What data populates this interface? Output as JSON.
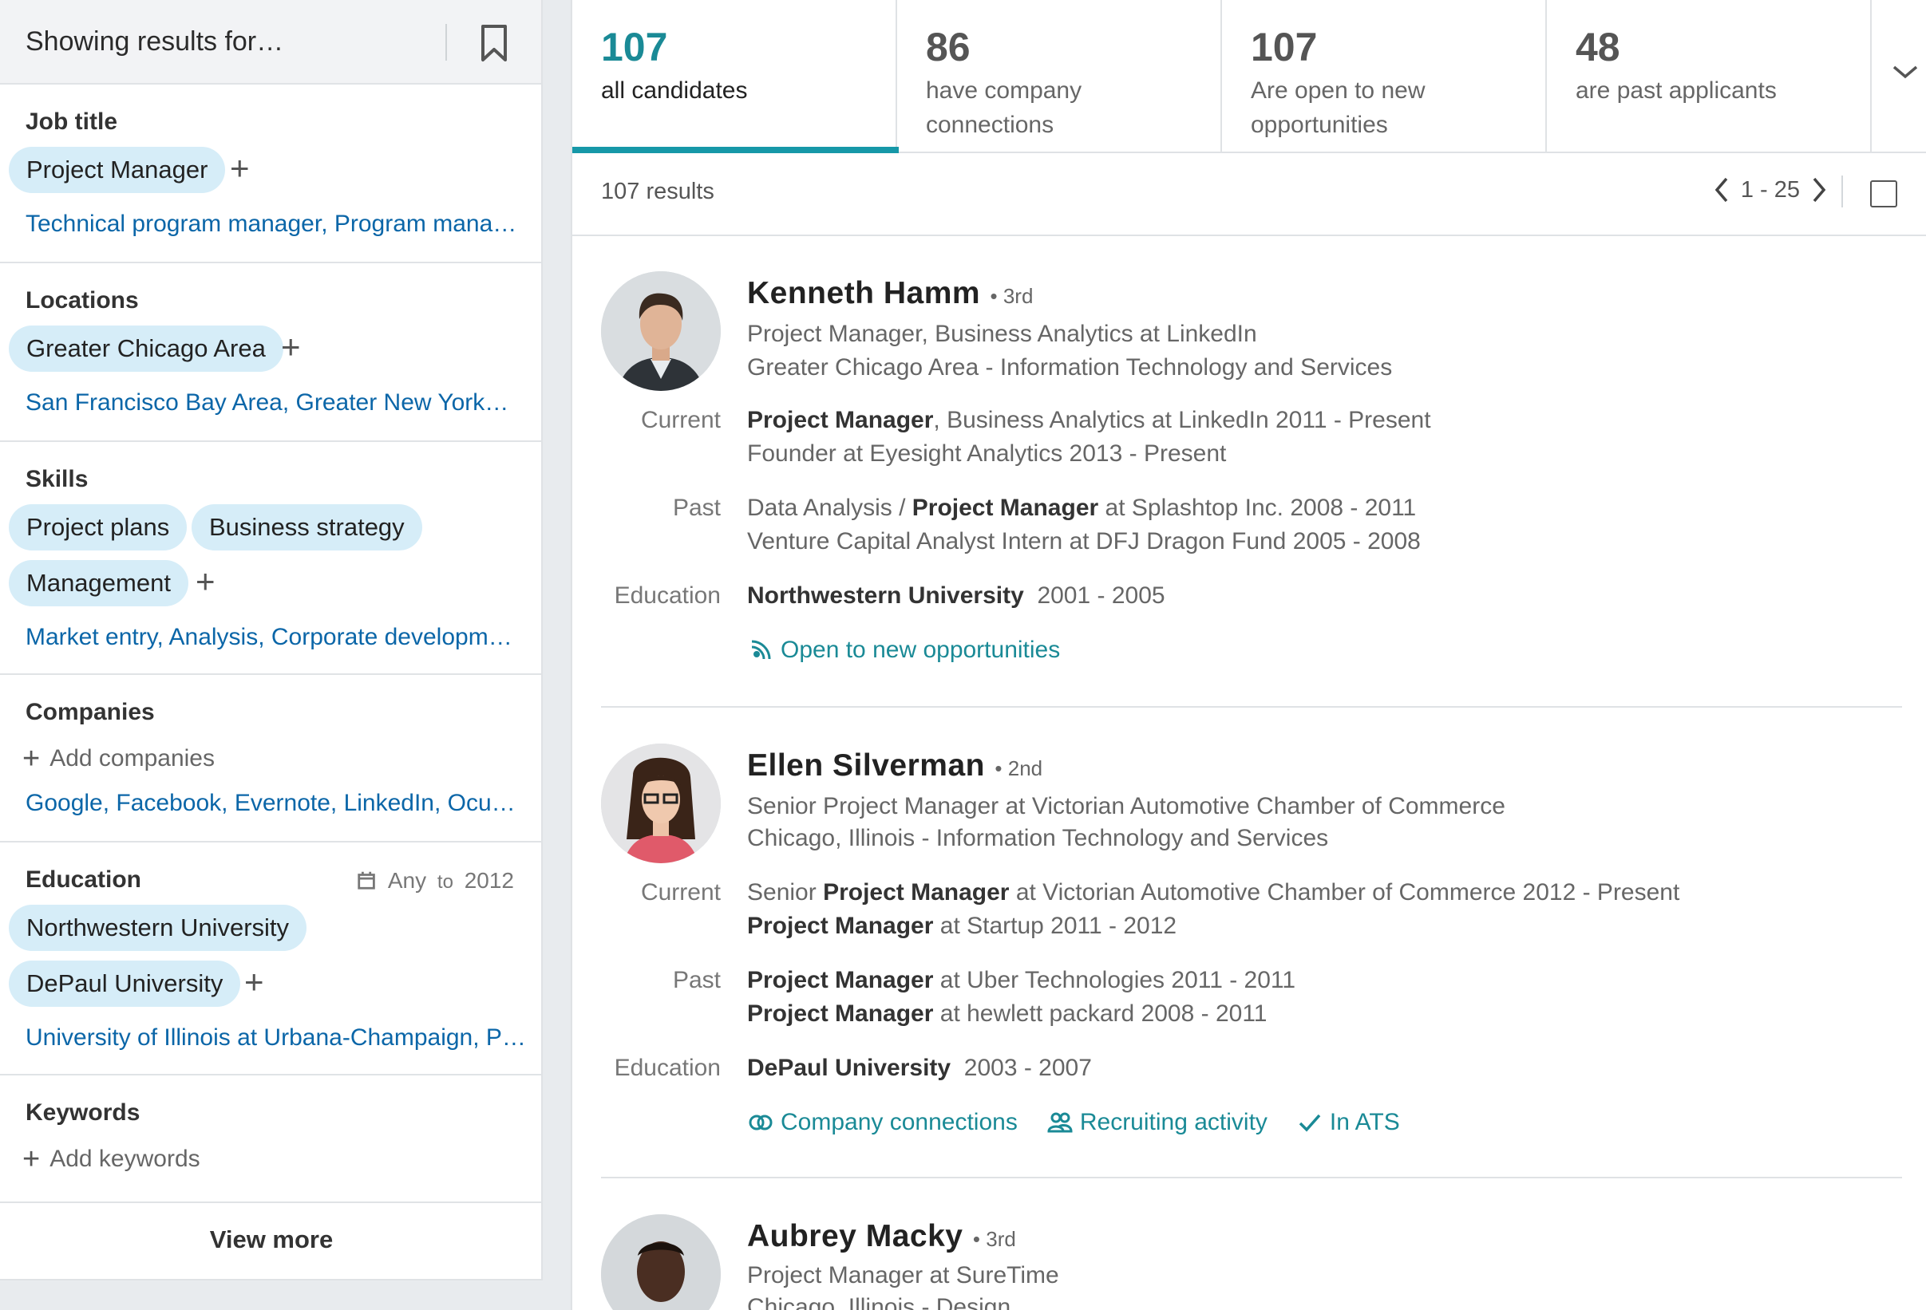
{
  "sidebar": {
    "header_title": "Showing results for…",
    "job_title": {
      "title": "Job title",
      "pills": [
        "Project Manager"
      ],
      "suggestion": "Technical program manager, Program mana…"
    },
    "locations": {
      "title": "Locations",
      "pills": [
        "Greater Chicago Area"
      ],
      "suggestion": "San Francisco Bay Area, Greater New York…"
    },
    "skills": {
      "title": "Skills",
      "pills": [
        "Project plans",
        "Business strategy",
        "Management"
      ],
      "suggestion": "Market entry, Analysis, Corporate developm…"
    },
    "companies": {
      "title": "Companies",
      "add_label": "Add companies",
      "suggestion": "Google, Facebook, Evernote, LinkedIn, Ocu…"
    },
    "education": {
      "title": "Education",
      "range_from": "Any",
      "range_to_label": "to",
      "range_to": "2012",
      "pills": [
        "Northwestern University",
        "DePaul University"
      ],
      "suggestion": "University of Illinois at Urbana-Champaign, P…"
    },
    "keywords": {
      "title": "Keywords",
      "add_label": "Add keywords"
    },
    "view_more": "View more"
  },
  "tabs": [
    {
      "count": "107",
      "label": "all candidates",
      "active": true
    },
    {
      "count": "86",
      "label": "have company connections"
    },
    {
      "count": "107",
      "label": "Are open to new opportunities"
    },
    {
      "count": "48",
      "label": "are past applicants"
    }
  ],
  "results": {
    "count_label": "107 results",
    "page_range": "1 - 25"
  },
  "labels": {
    "current": "Current",
    "past": "Past",
    "education": "Education"
  },
  "candidates": [
    {
      "name": "Kenneth Hamm",
      "degree": "• 3rd",
      "headline": "Project Manager, Business Analytics at LinkedIn",
      "location": "Greater Chicago Area - Information Technology and Services",
      "current": [
        {
          "pre": "",
          "bold": "Project Manager",
          "post": ", Business Analytics at LinkedIn  2011 - Present"
        },
        {
          "pre": "Founder at Eyesight Analytics  2013 - Present",
          "bold": "",
          "post": ""
        }
      ],
      "past": [
        {
          "pre": "Data Analysis / ",
          "bold": "Project Manager",
          "post": " at Splashtop Inc.  2008 - 2011"
        },
        {
          "pre": "Venture Capital Analyst Intern at DFJ Dragon Fund  2005 - 2008",
          "bold": "",
          "post": ""
        }
      ],
      "education": {
        "school": "Northwestern University",
        "years": "2001 - 2005"
      },
      "tags": [
        "Open to new opportunities"
      ]
    },
    {
      "name": "Ellen Silverman",
      "degree": "• 2nd",
      "headline": "Senior Project Manager at Victorian Automotive Chamber of Commerce",
      "location": "Chicago, Illinois - Information Technology and Services",
      "current": [
        {
          "pre": "Senior ",
          "bold": "Project Manager",
          "post": " at Victorian Automotive Chamber of Commerce 2012 - Present"
        },
        {
          "pre": "",
          "bold": "Project Manager",
          "post": " at Startup 2011 - 2012"
        }
      ],
      "past": [
        {
          "pre": "",
          "bold": "Project Manager",
          "post": " at Uber Technologies  2011 - 2011"
        },
        {
          "pre": "",
          "bold": "Project Manager",
          "post": " at hewlett packard 2008 - 2011"
        }
      ],
      "education": {
        "school": "DePaul University",
        "years": "2003 - 2007"
      },
      "tags": [
        "Company connections",
        "Recruiting activity",
        "In ATS"
      ]
    },
    {
      "name": "Aubrey Macky",
      "degree": "• 3rd",
      "headline": "Project Manager at SureTime",
      "location": "Chicago, Illinois - Design"
    }
  ],
  "colors": {
    "accent": "#1698a8",
    "link": "#0b66a8",
    "pill": "#d6edf8"
  }
}
